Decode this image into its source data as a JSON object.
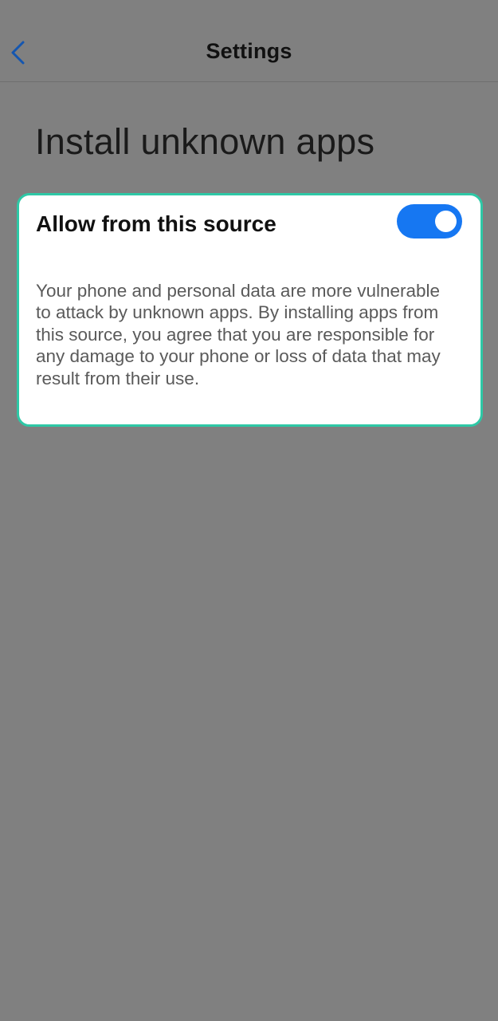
{
  "header": {
    "back_icon": "chevron-left-icon",
    "title": "Settings"
  },
  "page": {
    "title": "Install unknown apps"
  },
  "setting": {
    "label": "Allow from this source",
    "toggle_on": true,
    "description": "Your phone and personal data are more vulnerable to attack by unknown apps. By installing apps from this source, you agree that you are responsible for any damage to your phone or loss of data that may result from their use."
  },
  "colors": {
    "background": "#808080",
    "accent": "#1677f2",
    "highlight_border": "#2ec8a6",
    "card": "#ffffff"
  }
}
